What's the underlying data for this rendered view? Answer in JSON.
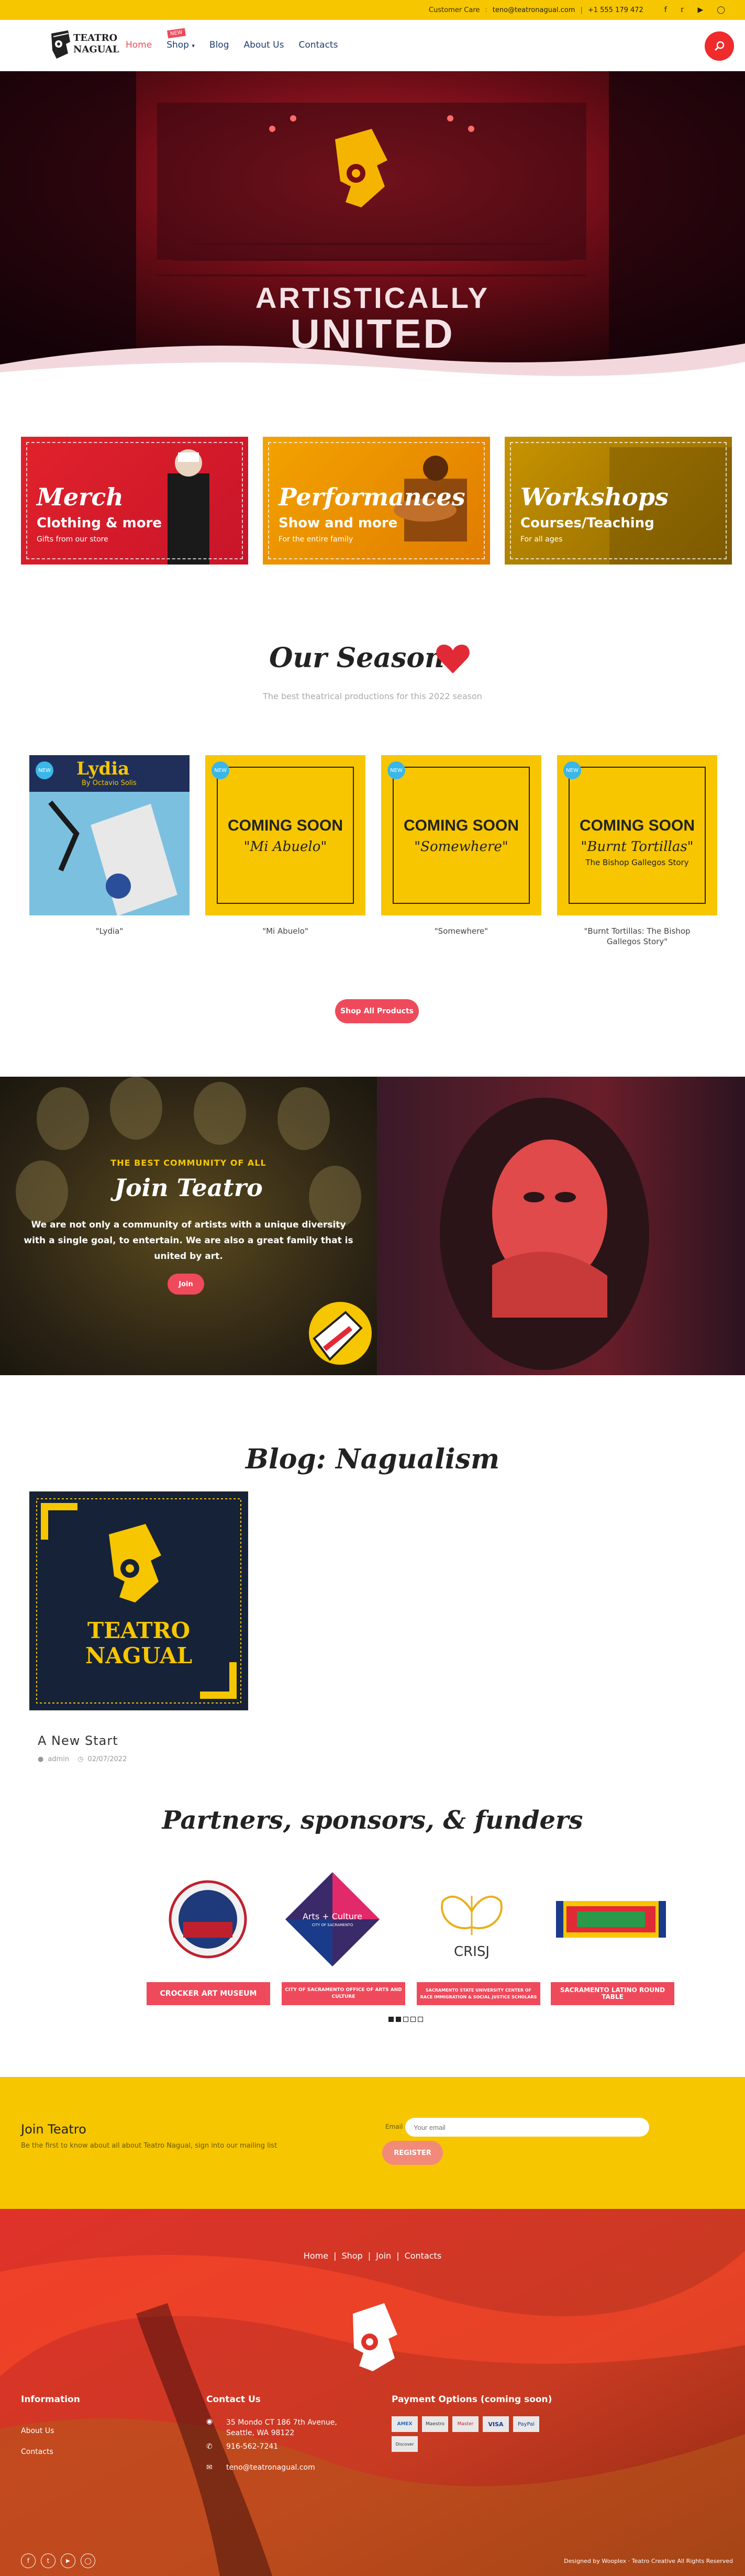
{
  "topbar": {
    "customer_care_label": "Customer Care",
    "email": "teno@teatronagual.com",
    "phone": "+1 555 179 472",
    "social_icons": [
      "facebook-icon",
      "twitter-icon",
      "youtube-icon",
      "instagram-icon"
    ]
  },
  "header": {
    "logo_text_1": "TEATRO",
    "logo_text_2": "NAGUAL",
    "nav": [
      "Home",
      "Shop",
      "Blog",
      "About Us",
      "Contacts"
    ],
    "shop_badge": "NEW",
    "search_icon": "search-icon"
  },
  "hero": {
    "title_1": "ARTISTICALLY",
    "title_2": "UNITED"
  },
  "cards": [
    {
      "title": "Merch",
      "subtitle": "Clothing & more",
      "desc": "Gifts from our store"
    },
    {
      "title": "Performances",
      "subtitle": "Show and more",
      "desc": "For the entire family"
    },
    {
      "title": "Workshops",
      "subtitle": "Courses/Teaching",
      "desc": "For all ages"
    }
  ],
  "season": {
    "title": "Our Season",
    "subtitle": "The best theatrical productions for this 2022 season",
    "button": "Shop All Products",
    "products": [
      {
        "name": "\"Lydia\"",
        "badge": "NEW",
        "poster_title": "Lydia",
        "poster_author": "By Octavio Solis"
      },
      {
        "name": "\"Mi Abuelo\"",
        "badge": "NEW",
        "coming": "COMING SOON",
        "show": "\"Mi Abuelo\"",
        "show_sub": ""
      },
      {
        "name": "\"Somewhere\"",
        "badge": "NEW",
        "coming": "COMING SOON",
        "show": "\"Somewhere\"",
        "show_sub": ""
      },
      {
        "name": "\"Burnt Tortillas: The Bishop Gallegos Story\"",
        "badge": "NEW",
        "coming": "COMING SOON",
        "show": "\"Burnt Tortillas\"",
        "show_sub": "The Bishop Gallegos Story"
      }
    ]
  },
  "join": {
    "kicker": "THE BEST COMMUNITY OF ALL",
    "title": "Join Teatro",
    "body": "We are not only a community of artists with a unique diversity with a single goal, to entertain. We are also a great family that is united by art.",
    "button": "Join"
  },
  "blog": {
    "title": "Blog: Nagualism",
    "post_title": "A New Start",
    "post_author": "admin",
    "post_date": "02/07/2022",
    "logo_text_1": "TEATRO",
    "logo_text_2": "NAGUAL"
  },
  "partners": {
    "title": "Partners, sponsors, & funders",
    "items": [
      {
        "label": "CROCKER ART MUSEUM"
      },
      {
        "label": "CITY OF SACRAMENTO OFFICE OF ARTS AND CULTURE",
        "logo_text_1": "Arts + Culture",
        "logo_text_2": "CITY OF SACRAMENTO"
      },
      {
        "label": "SACRAMENTO STATE UNIVERSITY CENTER OF RACE IMMIGRATION & SOCIAL JUSTICE SCHOLARS",
        "logo_text": "CRISJ"
      },
      {
        "label": "SACRAMENTO LATINO ROUND TABLE"
      }
    ]
  },
  "newsletter": {
    "title": "Join Teatro",
    "desc": "Be the first to know about all about Teatro Nagual, sign into our mailing list",
    "email_label": "Email",
    "placeholder": "Your email",
    "button": "REGISTER"
  },
  "footer": {
    "links": [
      "Home",
      "Shop",
      "Join",
      "Contacts"
    ],
    "info_title": "Information",
    "info_links": [
      "About Us",
      "Contacts"
    ],
    "contact_title": "Contact Us",
    "address": "35 Mondo CT 186 7th Avenue, Seattle, WA 98122",
    "phone": "916-562-7241",
    "email": "teno@teatronagual.com",
    "payment_title": "Payment Options (coming soon)",
    "payments": [
      "AMEX",
      "Maestro",
      "Master",
      "VISA",
      "PayPal",
      "Discover"
    ],
    "credit": "Designed by Wooplex · Teatro Creative All Rights Reserved",
    "social_icons": [
      "facebook-icon",
      "twitter-icon",
      "youtube-icon",
      "instagram-icon"
    ]
  }
}
